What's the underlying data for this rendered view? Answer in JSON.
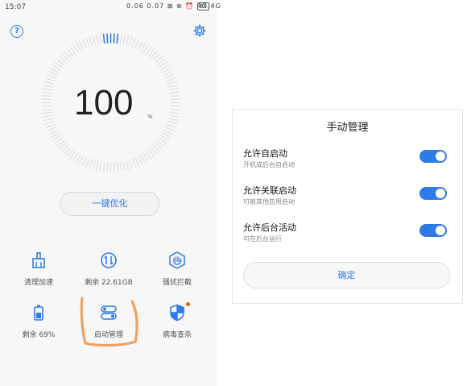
{
  "status": {
    "time": "15:07",
    "icons_text": "0.06 0.07 ⊠ ⊗ ⏰ 4G 4G",
    "battery": "69"
  },
  "score": {
    "value": "100",
    "unit": "%"
  },
  "optimize_label": "一键优化",
  "tools": [
    {
      "label": "清理加速",
      "icon": "broom-icon"
    },
    {
      "label": "剩余 22.61GB",
      "icon": "storage-icon"
    },
    {
      "label": "骚扰拦截",
      "icon": "hand-icon"
    },
    {
      "label": "剩余 69%",
      "icon": "battery-icon"
    },
    {
      "label": "启动管理",
      "icon": "toggle-icon"
    },
    {
      "label": "病毒查杀",
      "icon": "shield-icon"
    }
  ],
  "dialog": {
    "title": "手动管理",
    "rows": [
      {
        "title": "允许自启动",
        "subtitle": "开机或后台自启动",
        "enabled": true
      },
      {
        "title": "允许关联启动",
        "subtitle": "可被其他应用启动",
        "enabled": true
      },
      {
        "title": "允许后台活动",
        "subtitle": "可在后台运行",
        "enabled": true
      }
    ],
    "confirm_label": "确定"
  },
  "colors": {
    "accent": "#2f7be5",
    "annotation": "#f0a060",
    "badge": "#e8533a"
  }
}
